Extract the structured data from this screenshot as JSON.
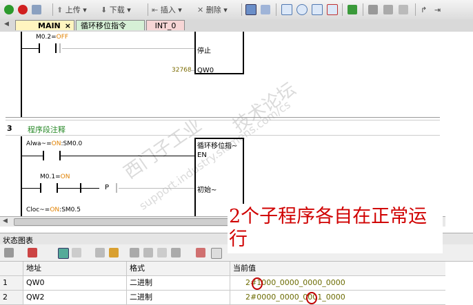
{
  "toolbar": {
    "upload": "上传",
    "download": "下载",
    "insert": "插入",
    "delete": "删除"
  },
  "tabs": [
    {
      "label": "MAIN"
    },
    {
      "label": "循环移位指令"
    },
    {
      "label": "INT_0"
    }
  ],
  "tab_close": "×",
  "network1": {
    "contact_label_prefix": "M0.2=",
    "contact_state": "OFF",
    "stop_label": "停止",
    "value_label": "32768",
    "output_label": "QW0"
  },
  "network2": {
    "number": "3",
    "comment": "程序段注释",
    "contact1_prefix": "Alwa~=",
    "contact1_state": "ON",
    "contact1_addr": ":SM0.0",
    "box_title": "循环移位指~",
    "en_label": "EN",
    "contact2_prefix": "M0.1=",
    "contact2_state": "ON",
    "p_label": "P",
    "init_label": "初始~",
    "contact3_prefix": "Cloc~=",
    "contact3_state": "ON",
    "contact3_addr": ":SM0.5"
  },
  "watermark": {
    "line1": "西门子工业",
    "line2": "技术论坛",
    "line3": "support.industry.siemens.com/cs"
  },
  "status_chart": {
    "title": "状态图表",
    "columns": [
      "",
      "地址",
      "格式",
      "当前值"
    ],
    "rows": [
      {
        "index": "1",
        "address": "QW0",
        "format": "二进制",
        "value": "2#1000_0000_0000_0000"
      },
      {
        "index": "2",
        "address": "QW2",
        "format": "二进制",
        "value": "2#0000_0000_0001_0000"
      }
    ]
  },
  "annotation": {
    "text": "2个子程序各自在正常运行"
  }
}
